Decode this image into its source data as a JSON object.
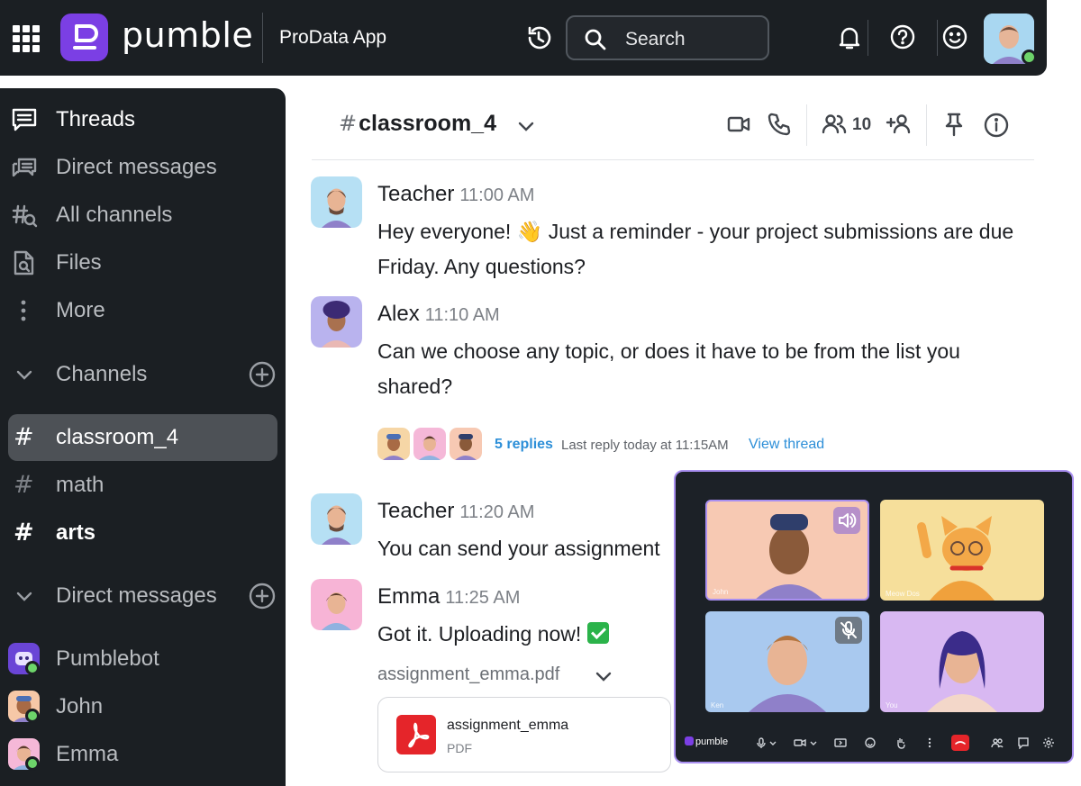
{
  "app": {
    "brand": "pumble",
    "workspace": "ProData App"
  },
  "search": {
    "placeholder": "Search"
  },
  "icons": {
    "apps": "grid-apps-icon",
    "history": "history-icon",
    "search": "search-icon",
    "notifications": "bell-icon",
    "help": "help-icon",
    "status": "emoji-icon"
  },
  "colors": {
    "brand": "#7b3fe4",
    "sidebar_bg": "#1b1f23",
    "active_channel": "#4d5156",
    "online": "#6dd46a",
    "link": "#2d8fd8",
    "pdf": "#e5252a",
    "call_border": "#a98ff0"
  },
  "sidebar": {
    "nav": [
      {
        "label": "Threads",
        "icon": "threads-icon"
      },
      {
        "label": "Direct messages",
        "icon": "direct-messages-icon"
      },
      {
        "label": "All channels",
        "icon": "all-channels-icon"
      },
      {
        "label": "Files",
        "icon": "files-icon"
      },
      {
        "label": "More",
        "icon": "more-icon"
      }
    ],
    "channels_section": "Channels",
    "channels": [
      {
        "name": "classroom_4",
        "state": "active"
      },
      {
        "name": "math",
        "state": "read"
      },
      {
        "name": "arts",
        "state": "unread"
      }
    ],
    "dm_section": "Direct messages",
    "dms": [
      {
        "name": "Pumblebot",
        "online": true
      },
      {
        "name": "John",
        "online": true
      },
      {
        "name": "Emma",
        "online": true
      }
    ]
  },
  "channel": {
    "name": "classroom_4",
    "member_count": "10"
  },
  "messages": [
    {
      "author": "Teacher",
      "time": "11:00 AM",
      "text_before": "Hey everyone!",
      "emoji": "👋",
      "text_after": "Just a reminder - your project submissions are due Friday. Any questions?"
    },
    {
      "author": "Alex",
      "time": "11:10 AM",
      "text": "Can we choose any topic, or does it have to be from the list you shared?"
    },
    {
      "author": "Teacher",
      "time": "11:20 AM",
      "text": "You can send your assignment"
    },
    {
      "author": "Emma",
      "time": "11:25 AM",
      "text": "Got it. Uploading now!"
    }
  ],
  "thread": {
    "replies": "5 replies",
    "last_reply": "Last reply today at 11:15AM",
    "view": "View thread"
  },
  "attachment": {
    "label": "assignment_emma.pdf",
    "title": "assignment_emma",
    "type": "PDF"
  },
  "call": {
    "brand": "pumble",
    "participants": [
      {
        "name": "John",
        "bg": "#f7c9b3",
        "badge": "speaker-icon"
      },
      {
        "name": "Meow Dos",
        "bg": "#f6df9b",
        "badge": ""
      },
      {
        "name": "Ken",
        "bg": "#a9c9ef",
        "badge": "muted-mic-icon"
      },
      {
        "name": "You",
        "bg": "#d8b8f2",
        "badge": ""
      }
    ]
  }
}
